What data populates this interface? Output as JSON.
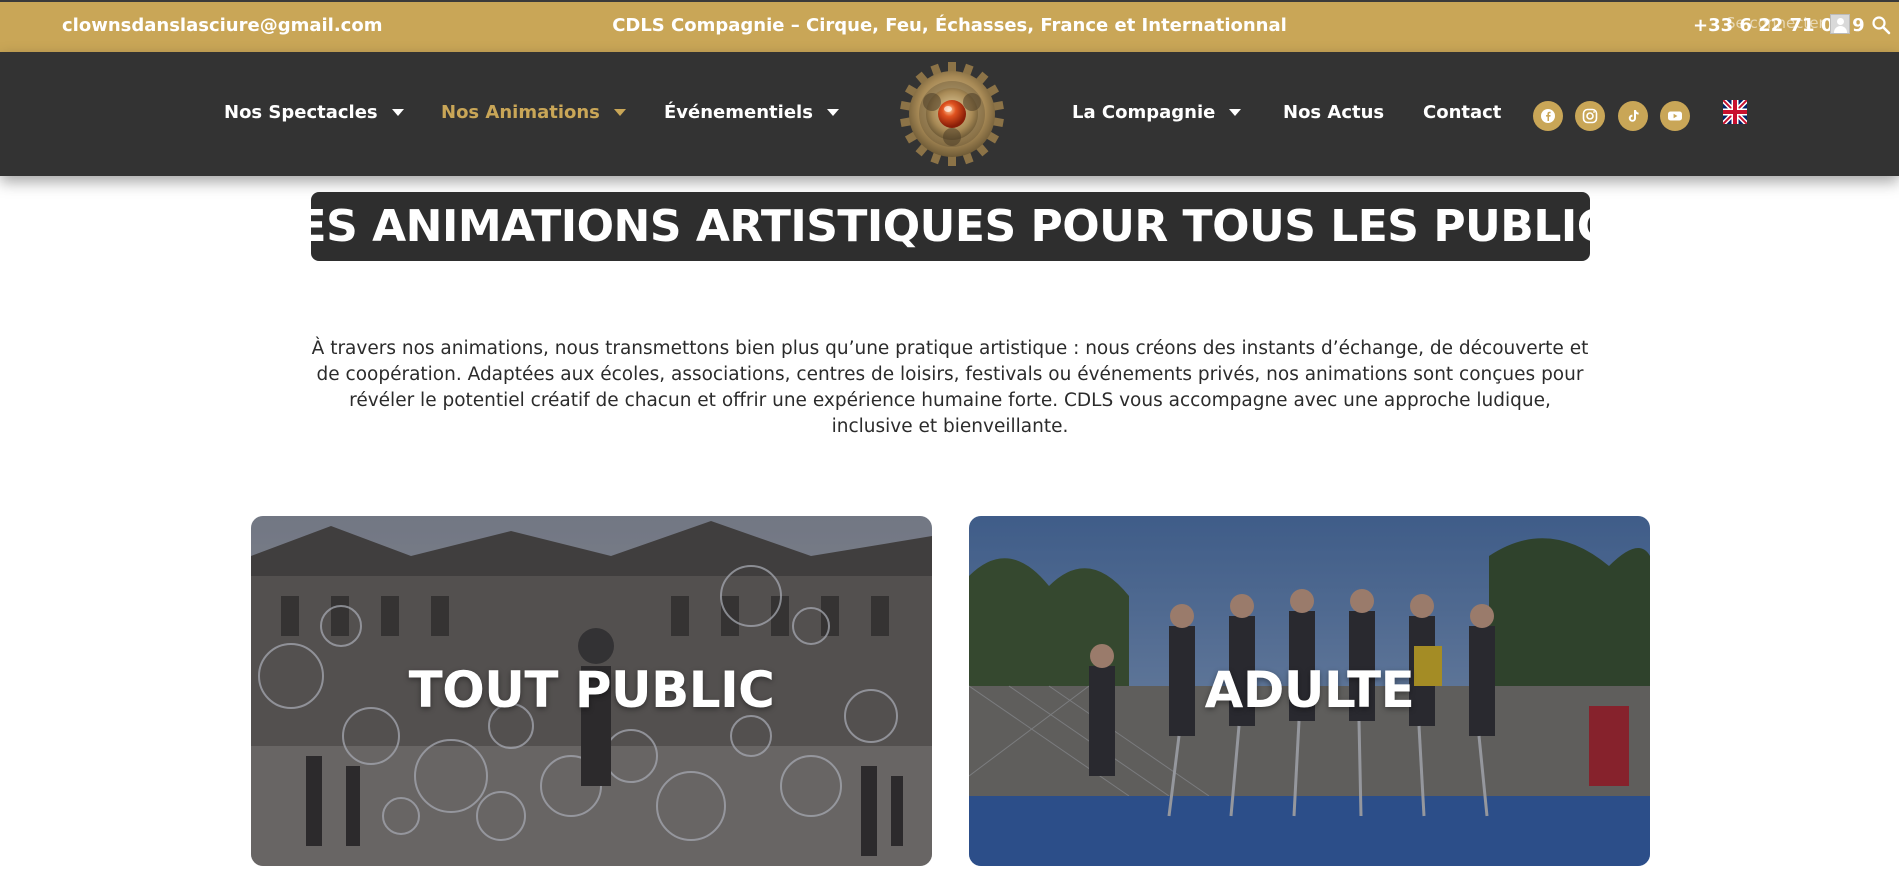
{
  "topbar": {
    "email": "clownsdanslasciure@gmail.com",
    "tagline": "CDLS Compagnie – Cirque, Feu, Échasses, France et Internationnal",
    "phone": "+33 6 22 71 04 9",
    "login": "Se connecter"
  },
  "nav": {
    "items": [
      {
        "label": "Nos Spectacles",
        "dropdown": true
      },
      {
        "label": "Nos Animations",
        "dropdown": true,
        "active": true
      },
      {
        "label": "Événementiels",
        "dropdown": true
      },
      {
        "label": "La Compagnie",
        "dropdown": true
      },
      {
        "label": "Nos Actus",
        "dropdown": false
      },
      {
        "label": "Contact",
        "dropdown": false
      }
    ],
    "social": [
      "facebook-icon",
      "instagram-icon",
      "tiktok-icon",
      "youtube-icon"
    ],
    "language_flag": "uk-flag-icon"
  },
  "hero": {
    "title": "DES ANIMATIONS ARTISTIQUES POUR TOUS LES PUBLICS",
    "intro": "À travers nos animations, nous transmettons bien plus qu’une pratique artistique : nous créons des instants d’échange, de découverte et de coopération. Adaptées aux écoles, associations, centres de loisirs, festivals ou événements privés, nos animations sont conçues pour révéler le potentiel créatif de chacun et offrir une expérience humaine forte. CDLS vous accompagne avec une approche ludique, inclusive et bienveillante."
  },
  "cards": [
    {
      "title": "TOUT PUBLIC"
    },
    {
      "title": "ADULTE"
    }
  ],
  "colors": {
    "gold": "#c9a657",
    "dark": "#333333",
    "title_box": "#2e2e2e"
  }
}
